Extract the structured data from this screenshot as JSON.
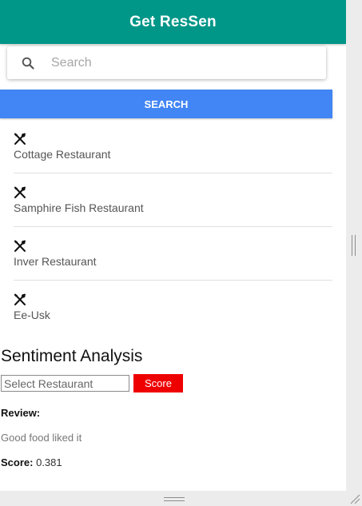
{
  "header": {
    "title": "Get ResSen"
  },
  "search": {
    "placeholder": "Search",
    "value": "",
    "button_label": "SEARCH"
  },
  "restaurants": [
    {
      "name": "Cottage Restaurant",
      "icon": "utensils-icon"
    },
    {
      "name": "Samphire Fish Restaurant",
      "icon": "utensils-icon"
    },
    {
      "name": "Inver Restaurant",
      "icon": "utensils-icon"
    },
    {
      "name": "Ee-Usk",
      "icon": "utensils-icon"
    }
  ],
  "sentiment": {
    "title": "Sentiment Analysis",
    "select_placeholder": "Select Restaurant",
    "score_button_label": "Score",
    "review_label": "Review:",
    "review_text": "Good food liked it",
    "score_label": "Score:",
    "score_value": "0.381"
  },
  "colors": {
    "header": "#009688",
    "search_button": "#4285f4",
    "score_button": "#ef0000"
  }
}
